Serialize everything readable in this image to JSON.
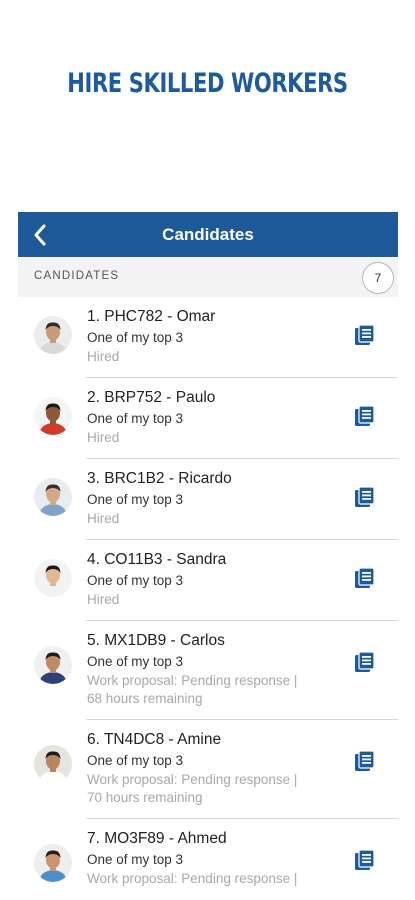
{
  "hero_title": "HIRE SKILLED WORKERS",
  "navbar": {
    "title": "Candidates"
  },
  "section": {
    "label": "CANDIDATES",
    "count": "7"
  },
  "candidates": [
    {
      "name": "1. PHC782 - Omar",
      "subtitle": "One of my top 3",
      "status": "Hired",
      "status2": ""
    },
    {
      "name": "2. BRP752 - Paulo",
      "subtitle": "One of my top 3",
      "status": "Hired",
      "status2": ""
    },
    {
      "name": "3. BRC1B2 - Ricardo",
      "subtitle": "One of my top 3",
      "status": "Hired",
      "status2": ""
    },
    {
      "name": "4. CO11B3 - Sandra",
      "subtitle": "One of my top 3",
      "status": "Hired",
      "status2": ""
    },
    {
      "name": "5. MX1DB9 - Carlos",
      "subtitle": "One of my top 3",
      "status": "Work proposal: Pending response |",
      "status2": "68 hours remaining"
    },
    {
      "name": "6. TN4DC8 - Amine",
      "subtitle": "One of my top 3",
      "status": "Work proposal: Pending response |",
      "status2": "70 hours remaining"
    },
    {
      "name": "7. MO3F89 - Ahmed",
      "subtitle": "One of my top 3",
      "status": "Work proposal: Pending response |",
      "status2": ""
    }
  ],
  "colors": {
    "brand": "#1e5a99",
    "hero": "#1d5aa0",
    "muted": "#a8a8a8"
  },
  "icons": {
    "back": "chevron-left-icon",
    "document": "document-icon"
  }
}
